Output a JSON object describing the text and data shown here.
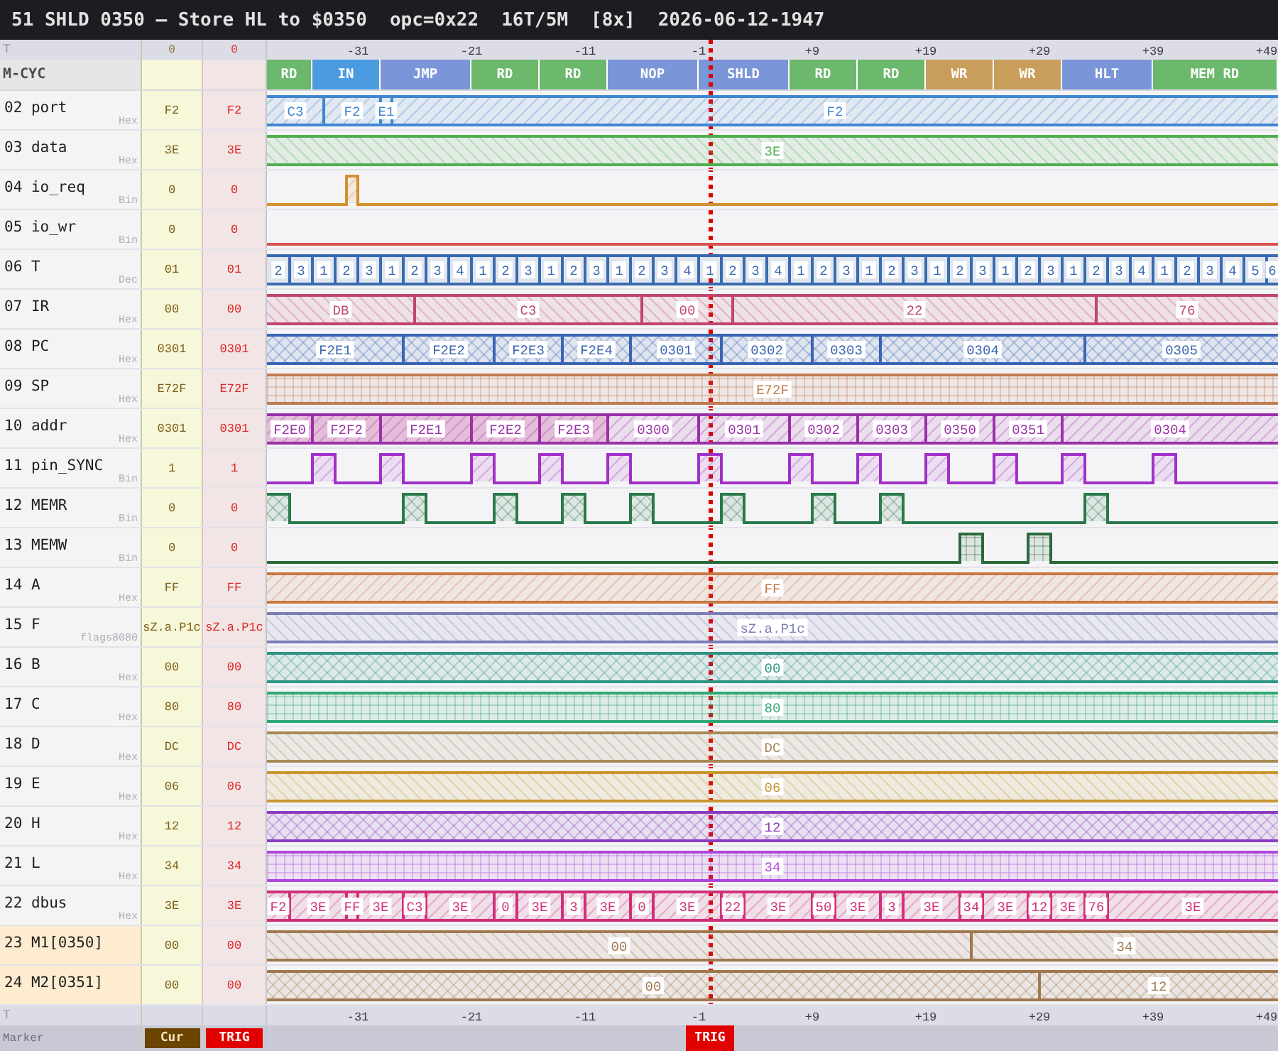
{
  "title_bar": {
    "instruction": "51 SHLD 0350 — Store HL to $0350",
    "opcode": "opc=0x22",
    "timing": "16T/5M",
    "zoom": "[8x]",
    "timestamp": "2026-06-12-1947"
  },
  "top_axis": {
    "label": "T",
    "cur_header": "0",
    "trig_header": "0",
    "ticks": [
      "-31",
      "-21",
      "-11",
      "-1",
      "+9",
      "+19",
      "+29",
      "+39",
      "+49"
    ]
  },
  "m_cycles": {
    "label": "M-CYC",
    "blocks": [
      {
        "label": "RD",
        "color": "#6cb86c"
      },
      {
        "label": "IN",
        "color": "#4b9be0"
      },
      {
        "label": "JMP",
        "color": "#7b96d8"
      },
      {
        "label": "RD",
        "color": "#6cb86c"
      },
      {
        "label": "RD",
        "color": "#6cb86c"
      },
      {
        "label": "NOP",
        "color": "#7b96d8"
      },
      {
        "label": "SHLD",
        "color": "#7b96d8"
      },
      {
        "label": "RD",
        "color": "#6cb86c"
      },
      {
        "label": "RD",
        "color": "#6cb86c"
      },
      {
        "label": "WR",
        "color": "#c99d5c"
      },
      {
        "label": "WR",
        "color": "#c99d5c"
      },
      {
        "label": "HLT",
        "color": "#7b96d8"
      },
      {
        "label": "MEM RD",
        "color": "#6cb86c"
      }
    ]
  },
  "signals": [
    {
      "name": "02 port",
      "format": "Hex",
      "cur": "F2",
      "trig": "F2",
      "memory_watch": false,
      "kind": "bus",
      "color": "#3f86d0",
      "segments": [
        {
          "value": "C3"
        },
        {
          "value": "F2"
        },
        {
          "value": "E1"
        },
        {
          "value": "F2"
        }
      ]
    },
    {
      "name": "03 data",
      "format": "Hex",
      "cur": "3E",
      "trig": "3E",
      "memory_watch": false,
      "kind": "bus",
      "color": "#4faf4f",
      "segments": [
        {
          "value": "3E"
        }
      ]
    },
    {
      "name": "04 io_req",
      "format": "Bin",
      "cur": "0",
      "trig": "0",
      "memory_watch": false,
      "kind": "bit",
      "color": "#d4902e"
    },
    {
      "name": "05 io_wr",
      "format": "Bin",
      "cur": "0",
      "trig": "0",
      "memory_watch": false,
      "kind": "bit",
      "color": "#d9534f"
    },
    {
      "name": "06 T",
      "format": "Dec",
      "cur": "01",
      "trig": "01",
      "memory_watch": false,
      "kind": "bus",
      "color": "#3a6ab0",
      "segments": [
        {
          "value": "2"
        },
        {
          "value": "3"
        },
        {
          "value": "1"
        },
        {
          "value": "2"
        },
        {
          "value": "3"
        },
        {
          "value": "1"
        },
        {
          "value": "2"
        },
        {
          "value": "3"
        },
        {
          "value": "4"
        },
        {
          "value": "1"
        },
        {
          "value": "2"
        },
        {
          "value": "3"
        },
        {
          "value": "1"
        },
        {
          "value": "2"
        },
        {
          "value": "3"
        },
        {
          "value": "1"
        },
        {
          "value": "2"
        },
        {
          "value": "3"
        },
        {
          "value": "4"
        },
        {
          "value": "1"
        },
        {
          "value": "2"
        },
        {
          "value": "3"
        },
        {
          "value": "4"
        },
        {
          "value": "1"
        },
        {
          "value": "2"
        },
        {
          "value": "3"
        },
        {
          "value": "1"
        },
        {
          "value": "2"
        },
        {
          "value": "3"
        },
        {
          "value": "1"
        },
        {
          "value": "2"
        },
        {
          "value": "3"
        },
        {
          "value": "1"
        },
        {
          "value": "2"
        },
        {
          "value": "3"
        },
        {
          "value": "1"
        },
        {
          "value": "2"
        },
        {
          "value": "3"
        },
        {
          "value": "4"
        },
        {
          "value": "1"
        },
        {
          "value": "2"
        },
        {
          "value": "3"
        },
        {
          "value": "4"
        },
        {
          "value": "5"
        },
        {
          "value": "6"
        }
      ]
    },
    {
      "name": "07 IR",
      "format": "Hex",
      "cur": "00",
      "trig": "00",
      "memory_watch": false,
      "kind": "bus",
      "color": "#c0456e",
      "segments": [
        {
          "value": "DB"
        },
        {
          "value": "C3"
        },
        {
          "value": "00"
        },
        {
          "value": "22"
        },
        {
          "value": "76"
        }
      ]
    },
    {
      "name": "08 PC",
      "format": "Hex",
      "cur": "0301",
      "trig": "0301",
      "memory_watch": false,
      "kind": "bus",
      "color": "#3a64b4",
      "segments": [
        {
          "value": "F2E1"
        },
        {
          "value": "F2E2"
        },
        {
          "value": "F2E3"
        },
        {
          "value": "F2E4"
        },
        {
          "value": "0301"
        },
        {
          "value": "0302"
        },
        {
          "value": "0303"
        },
        {
          "value": "0304"
        },
        {
          "value": "0305"
        }
      ]
    },
    {
      "name": "09 SP",
      "format": "Hex",
      "cur": "E72F",
      "trig": "E72F",
      "memory_watch": false,
      "kind": "bus",
      "color": "#c07a50",
      "segments": [
        {
          "value": "E72F"
        }
      ]
    },
    {
      "name": "10 addr",
      "format": "Hex",
      "cur": "0301",
      "trig": "0301",
      "memory_watch": false,
      "kind": "bus",
      "color": "#9b30a8",
      "segments": [
        {
          "value": "F2E0",
          "highlighted": true
        },
        {
          "value": "F2F2",
          "highlighted": true
        },
        {
          "value": "F2E1",
          "highlighted": true
        },
        {
          "value": "F2E2",
          "highlighted": true
        },
        {
          "value": "F2E3",
          "highlighted": true
        },
        {
          "value": "0300",
          "highlighted": false
        },
        {
          "value": "0301",
          "highlighted": false
        },
        {
          "value": "0302",
          "highlighted": false
        },
        {
          "value": "0303",
          "highlighted": false
        },
        {
          "value": "0350",
          "highlighted": false
        },
        {
          "value": "0351",
          "highlighted": false
        },
        {
          "value": "0304",
          "highlighted": false
        }
      ]
    },
    {
      "name": "11 pin_SYNC",
      "format": "Bin",
      "cur": "1",
      "trig": "1",
      "memory_watch": false,
      "kind": "bit",
      "color": "#a030c8"
    },
    {
      "name": "12 MEMR",
      "format": "Bin",
      "cur": "0",
      "trig": "0",
      "memory_watch": false,
      "kind": "bit",
      "color": "#2a7a4a"
    },
    {
      "name": "13 MEMW",
      "format": "Bin",
      "cur": "0",
      "trig": "0",
      "memory_watch": false,
      "kind": "bit",
      "color": "#2a6a3a"
    },
    {
      "name": "14 A",
      "format": "Hex",
      "cur": "FF",
      "trig": "FF",
      "memory_watch": false,
      "kind": "bus",
      "color": "#c87941",
      "segments": [
        {
          "value": "FF"
        }
      ]
    },
    {
      "name": "15 F",
      "format": "flags8080",
      "cur": "sZ.a.P1c",
      "trig": "sZ.a.P1c",
      "memory_watch": false,
      "kind": "bus",
      "color": "#7d7db8",
      "segments": [
        {
          "value": "sZ.a.P1c"
        }
      ]
    },
    {
      "name": "16 B",
      "format": "Hex",
      "cur": "00",
      "trig": "00",
      "memory_watch": false,
      "kind": "bus",
      "color": "#2f9484",
      "segments": [
        {
          "value": "00"
        }
      ]
    },
    {
      "name": "17 C",
      "format": "Hex",
      "cur": "80",
      "trig": "80",
      "memory_watch": false,
      "kind": "bus",
      "color": "#2fa874",
      "segments": [
        {
          "value": "80"
        }
      ]
    },
    {
      "name": "18 D",
      "format": "Hex",
      "cur": "DC",
      "trig": "DC",
      "memory_watch": false,
      "kind": "bus",
      "color": "#a88a58",
      "segments": [
        {
          "value": "DC"
        }
      ]
    },
    {
      "name": "19 E",
      "format": "Hex",
      "cur": "06",
      "trig": "06",
      "memory_watch": false,
      "kind": "bus",
      "color": "#c8962e",
      "segments": [
        {
          "value": "06"
        }
      ]
    },
    {
      "name": "20 H",
      "format": "Hex",
      "cur": "12",
      "trig": "12",
      "memory_watch": false,
      "kind": "bus",
      "color": "#8a3cc0",
      "segments": [
        {
          "value": "12"
        }
      ]
    },
    {
      "name": "21 L",
      "format": "Hex",
      "cur": "34",
      "trig": "34",
      "memory_watch": false,
      "kind": "bus",
      "color": "#ac48dc",
      "segments": [
        {
          "value": "34"
        }
      ]
    },
    {
      "name": "22 dbus",
      "format": "Hex",
      "cur": "3E",
      "trig": "3E",
      "memory_watch": false,
      "kind": "bus",
      "color": "#d0307a",
      "segments": [
        {
          "value": "F2"
        },
        {
          "value": "3E"
        },
        {
          "value": "FF"
        },
        {
          "value": "3E"
        },
        {
          "value": "C3"
        },
        {
          "value": "3E"
        },
        {
          "value": "0"
        },
        {
          "value": "3E"
        },
        {
          "value": "3"
        },
        {
          "value": "3E"
        },
        {
          "value": "0"
        },
        {
          "value": "3E"
        },
        {
          "value": "22"
        },
        {
          "value": "3E"
        },
        {
          "value": "50"
        },
        {
          "value": "3E"
        },
        {
          "value": "3"
        },
        {
          "value": "3E"
        },
        {
          "value": "34"
        },
        {
          "value": "3E"
        },
        {
          "value": "12"
        },
        {
          "value": "3E"
        },
        {
          "value": "76"
        },
        {
          "value": "3E"
        }
      ]
    },
    {
      "name": "23 M1[0350]",
      "cur": "00",
      "trig": "00",
      "memory_watch": true,
      "kind": "bus",
      "color": "#a07850",
      "segments": [
        {
          "value": "00"
        },
        {
          "value": "34"
        }
      ]
    },
    {
      "name": "24 M2[0351]",
      "cur": "00",
      "trig": "00",
      "memory_watch": true,
      "kind": "bus",
      "color": "#a07850",
      "segments": [
        {
          "value": "00"
        },
        {
          "value": "12"
        }
      ]
    }
  ],
  "bottom_axis": {
    "label": "T",
    "ticks": [
      "-31",
      "-21",
      "-11",
      "-1",
      "+9",
      "+19",
      "+29",
      "+39",
      "+49"
    ]
  },
  "marker_bar": {
    "label": "Marker",
    "cur_marker": "Cur",
    "trig_marker": "TRIG",
    "timeline_trigger": "TRIG"
  }
}
